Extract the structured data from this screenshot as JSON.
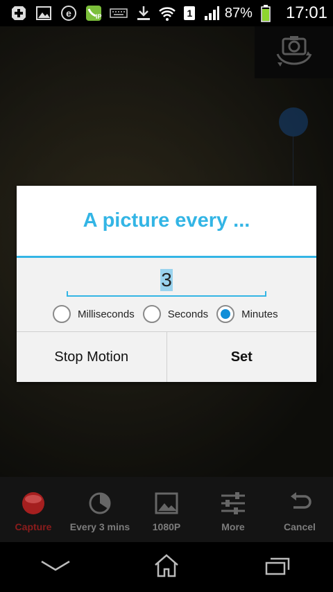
{
  "status_bar": {
    "battery_percent": "87%",
    "time": "17:01",
    "sim_slot": "1",
    "icons": [
      "plus-square-icon",
      "image-icon",
      "e-circle-icon",
      "ip-app-icon",
      "keyboard-icon",
      "download-icon",
      "wifi-icon",
      "sim-icon",
      "signal-icon",
      "battery-icon"
    ]
  },
  "camera": {
    "switch_icon": "camera-switch-icon"
  },
  "dialog": {
    "title": "A picture every ...",
    "interval_value": "3",
    "units": [
      {
        "label": "Milliseconds",
        "selected": false
      },
      {
        "label": "Seconds",
        "selected": false
      },
      {
        "label": "Minutes",
        "selected": true
      }
    ],
    "buttons": {
      "stop_motion": "Stop Motion",
      "set": "Set"
    },
    "accent_color": "#33b5e5"
  },
  "toolbar": {
    "items": [
      {
        "label": "Capture",
        "icon": "record-icon"
      },
      {
        "label": "Every 3 mins",
        "icon": "timer-icon"
      },
      {
        "label": "1080P",
        "icon": "image-icon"
      },
      {
        "label": "More",
        "icon": "sliders-icon"
      },
      {
        "label": "Cancel",
        "icon": "undo-icon"
      }
    ]
  },
  "navbar": {
    "icons": [
      "back-icon",
      "home-icon",
      "recent-apps-icon"
    ]
  }
}
